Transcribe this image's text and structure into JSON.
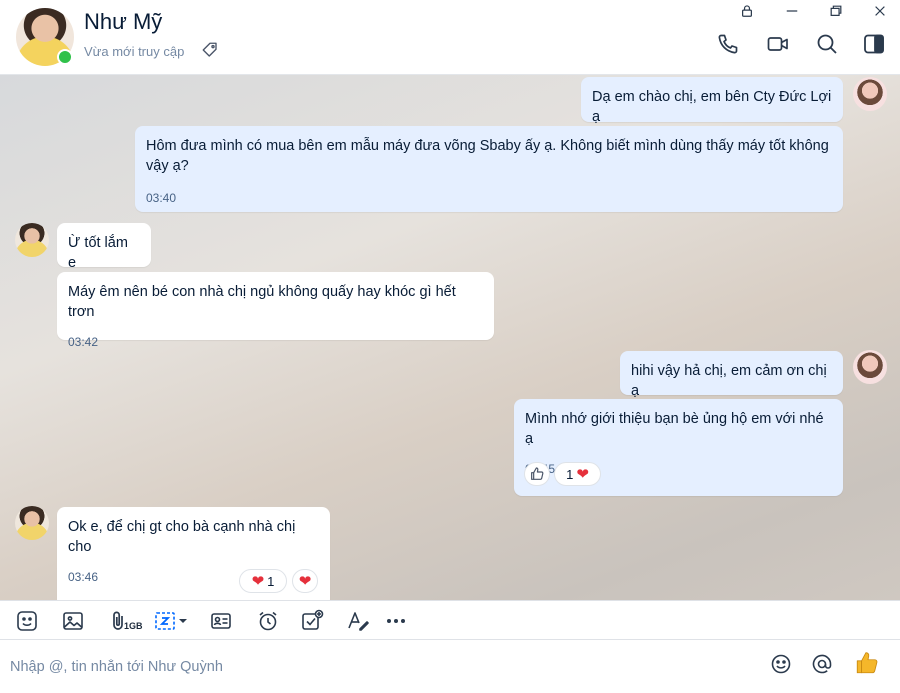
{
  "header": {
    "contact_name": "Như Mỹ",
    "status": "Vừa mới truy cập"
  },
  "messages": [
    {
      "side": "sent",
      "text": "Dạ em chào chị, em bên Cty Đức Lợi ạ"
    },
    {
      "side": "sent",
      "text": "Hôm đưa mình có mua bên em mẫu máy đưa võng Sbaby ấy ạ. Không biết mình dùng thấy máy tốt không vậy ạ?",
      "time": "03:40"
    },
    {
      "side": "received",
      "text": "Ừ tốt lắm e"
    },
    {
      "side": "received",
      "text": "Máy êm nên bé con nhà chị ngủ không quấy hay khóc gì hết trơn",
      "time": "03:42"
    },
    {
      "side": "sent",
      "text": "hihi vậy hả chị, em cảm ơn chị ạ"
    },
    {
      "side": "sent",
      "text": "Mình nhớ giới thiệu bạn bè ủng hộ em với nhé ạ",
      "time": "03:45",
      "reaction_count": "1"
    },
    {
      "side": "received",
      "text": "Ok e, để chị gt cho bà cạnh nhà chị cho",
      "time": "03:46",
      "reaction_count": "1"
    }
  ],
  "toolbar": {
    "file_size_badge": "1GB"
  },
  "composer": {
    "placeholder": "Nhập @, tin nhắn tới Như Quỳnh"
  },
  "colors": {
    "sent_bubble": "#e5efff",
    "received_bubble": "#ffffff",
    "online": "#30c14a",
    "heart": "#e5303b",
    "thumbs_up": "#f5b72a"
  }
}
